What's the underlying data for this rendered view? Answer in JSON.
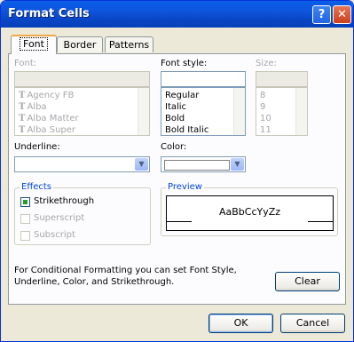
{
  "window": {
    "title": "Format Cells",
    "help_label": "?",
    "close_label": "✕"
  },
  "tabs": [
    {
      "label": "Font"
    },
    {
      "label": "Border"
    },
    {
      "label": "Patterns"
    }
  ],
  "font": {
    "label": "Font:",
    "value": "",
    "items": [
      "Agency FB",
      "Alba",
      "Alba Matter",
      "Alba Super"
    ]
  },
  "font_style": {
    "label": "Font style:",
    "value": "",
    "items": [
      "Regular",
      "Italic",
      "Bold",
      "Bold Italic"
    ]
  },
  "size": {
    "label": "Size:",
    "value": "",
    "items": [
      "8",
      "9",
      "10",
      "11"
    ]
  },
  "underline": {
    "label": "Underline:",
    "value": ""
  },
  "color": {
    "label": "Color:",
    "swatch": "#ffffff"
  },
  "effects": {
    "legend": "Effects",
    "strikethrough": "Strikethrough",
    "superscript": "Superscript",
    "subscript": "Subscript"
  },
  "preview": {
    "legend": "Preview",
    "sample": "AaBbCcYyZz"
  },
  "note": "For Conditional Formatting you can set Font Style, Underline, Color, and Strikethrough.",
  "buttons": {
    "clear": "Clear",
    "ok": "OK",
    "cancel": "Cancel"
  },
  "icons": {
    "dropdown": "chevron-down-icon",
    "truetype": "truetype-font-icon"
  }
}
